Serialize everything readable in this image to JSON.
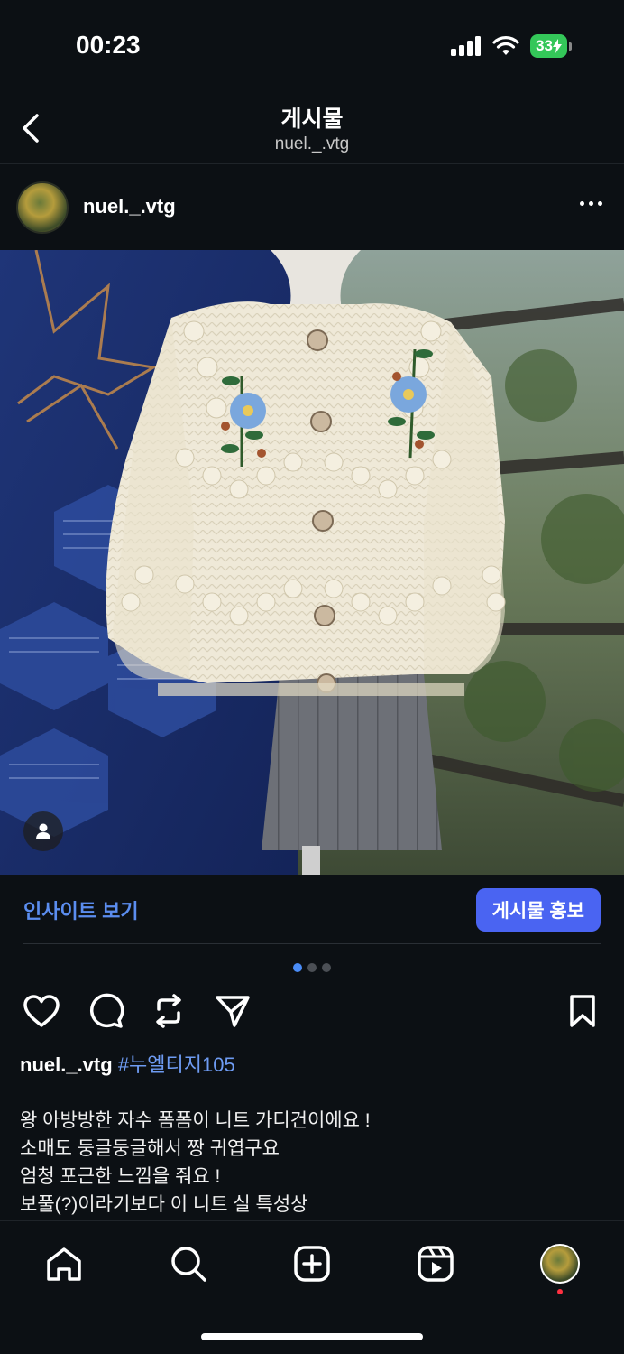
{
  "status_bar": {
    "time": "00:23",
    "battery": "33"
  },
  "header": {
    "title": "게시물",
    "subtitle": "nuel._.vtg"
  },
  "post": {
    "username": "nuel._.vtg"
  },
  "insight": {
    "link_label": "인사이트 보기",
    "promote_label": "게시물 홍보"
  },
  "carousel": {
    "count": 3,
    "active_index": 0
  },
  "caption": {
    "username": "nuel._.vtg",
    "hashtag": "#누엘티지105",
    "lines": [
      "왕 아방방한 자수 폼폼이 니트 가디건이에요 !",
      "소매도 둥글둥글해서 짱 귀엽구요",
      "엄청 포근한 느낌을 줘요 !",
      "보풀(?)이라기보다 이 니트 실 특성상"
    ]
  },
  "colors": {
    "accent": "#4a64f2",
    "link": "#5b8def",
    "hashtag": "#6e9bf2",
    "background": "#0c1014"
  },
  "icons": [
    "back-icon",
    "more-icon",
    "heart-icon",
    "comment-icon",
    "repost-icon",
    "share-icon",
    "bookmark-icon",
    "home-icon",
    "search-icon",
    "create-icon",
    "reels-icon",
    "person-icon"
  ]
}
